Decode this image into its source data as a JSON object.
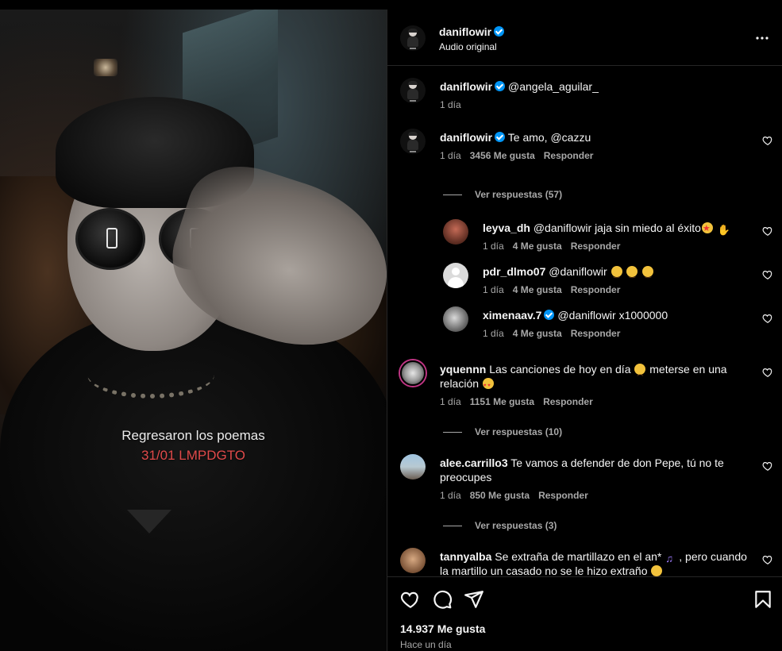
{
  "video": {
    "caption_line1": "Regresaron los poemas",
    "caption_line2": "31/01 LMPDGTO",
    "caption_line2_color": "#e04a4a"
  },
  "header": {
    "username": "daniflowir",
    "verified": true,
    "subtitle": "Audio original",
    "more_icon": "more-horizontal-icon"
  },
  "caption": {
    "username": "daniflowir",
    "text": "@angela_aguilar_",
    "time": "1 día"
  },
  "comments": [
    {
      "username": "daniflowir",
      "text": "Te amo, @cazzu",
      "time": "1 día",
      "likes": "3456 Me gusta",
      "reply_label": "Responder",
      "view_replies": "Ver respuestas (57)",
      "replies": [
        {
          "username": "leyva_dh",
          "text": "@daniflowir jaja sin miedo al éxito",
          "emojis": [
            "star-struck",
            "raising-hands"
          ],
          "time": "1 día",
          "likes": "4 Me gusta",
          "reply_label": "Responder"
        },
        {
          "username": "pdr_dlmo07",
          "text": "@daniflowir",
          "emojis": [
            "joy",
            "joy",
            "joy"
          ],
          "time": "1 día",
          "likes": "4 Me gusta",
          "reply_label": "Responder"
        },
        {
          "username": "ximenaav.7",
          "verified": true,
          "text": "@daniflowir x1000000",
          "time": "1 día",
          "likes": "4 Me gusta",
          "reply_label": "Responder"
        }
      ]
    },
    {
      "username": "yquennn",
      "text_before": "Las canciones de hoy en día",
      "text_after": "meterse en una relación",
      "emojis": [
        "sad",
        "hugging"
      ],
      "time": "1 día",
      "likes": "1151 Me gusta",
      "reply_label": "Responder",
      "view_replies": "Ver respuestas (10)"
    },
    {
      "username": "alee.carrillo3",
      "text": "Te vamos a defender de don Pepe, tú no te preocupes",
      "time": "1 día",
      "likes": "850 Me gusta",
      "reply_label": "Responder",
      "view_replies": "Ver respuestas (3)"
    },
    {
      "username": "tannyalba",
      "text_before": "Se extraña de martillazo en el an*",
      "text_after": ", pero cuando la martillo un casado no se le hizo extraño",
      "emojis": [
        "musical-notes",
        "joy"
      ]
    }
  ],
  "footer": {
    "likes": "14.937 Me gusta",
    "time": "Hace un día",
    "icons": [
      "heart-icon",
      "comment-icon",
      "share-icon",
      "bookmark-icon"
    ]
  }
}
